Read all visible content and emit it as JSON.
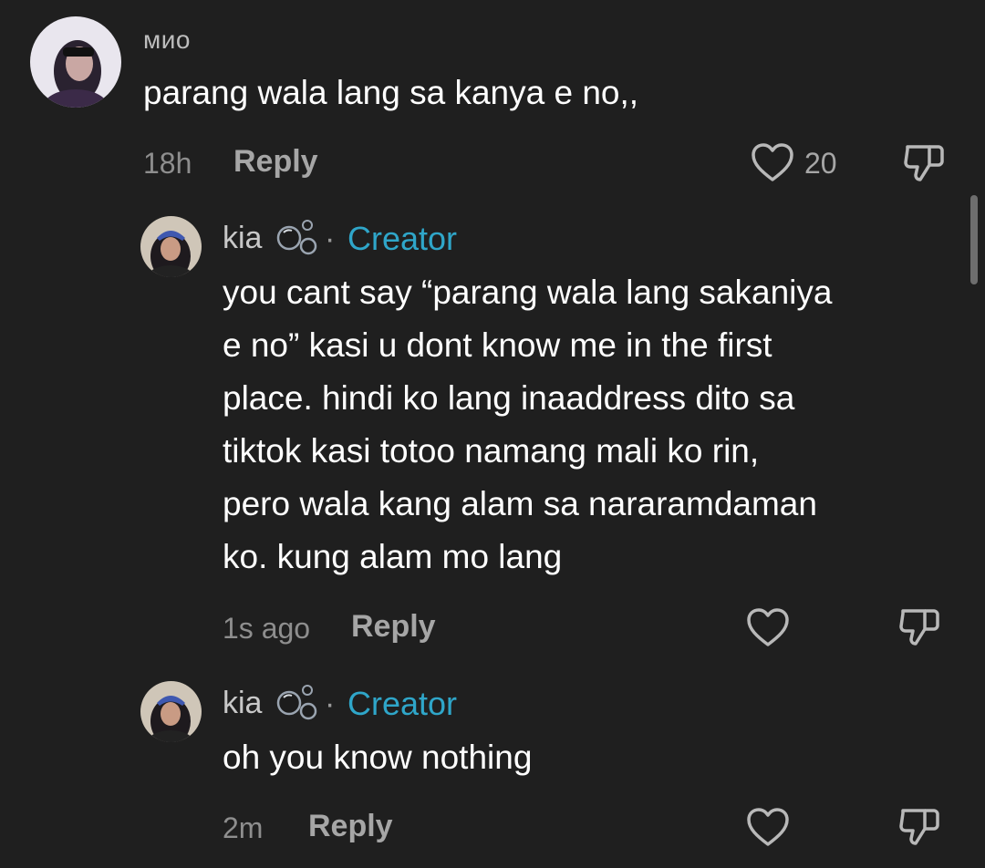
{
  "comments": [
    {
      "username": "мио",
      "text": "parang wala lang sa kanya e no,,",
      "time": "18h",
      "reply_label": "Reply",
      "likes": "20"
    },
    {
      "username": "kia",
      "badge": "Creator",
      "separator": "·",
      "text_lines": [
        "you cant say “parang wala lang sakaniya",
        "e no” kasi u dont know me in the first",
        "place. hindi ko lang inaaddress dito sa",
        "tiktok kasi totoo namang mali ko rin,",
        "pero wala kang alam sa nararamdaman",
        "ko. kung alam mo lang"
      ],
      "time": "1s ago",
      "reply_label": "Reply"
    },
    {
      "username": "kia",
      "badge": "Creator",
      "separator": "·",
      "text": "oh you know nothing",
      "time": "2m",
      "reply_label": "Reply"
    }
  ],
  "icons": {
    "like": "heart-icon",
    "dislike": "thumbs-down-icon",
    "bubbles": "bubbles-emoji-icon"
  },
  "colors": {
    "background": "#1f1f1f",
    "creator_accent": "#2fa6c9",
    "primary_text": "#ffffff",
    "secondary_text": "#a6a6a6"
  }
}
